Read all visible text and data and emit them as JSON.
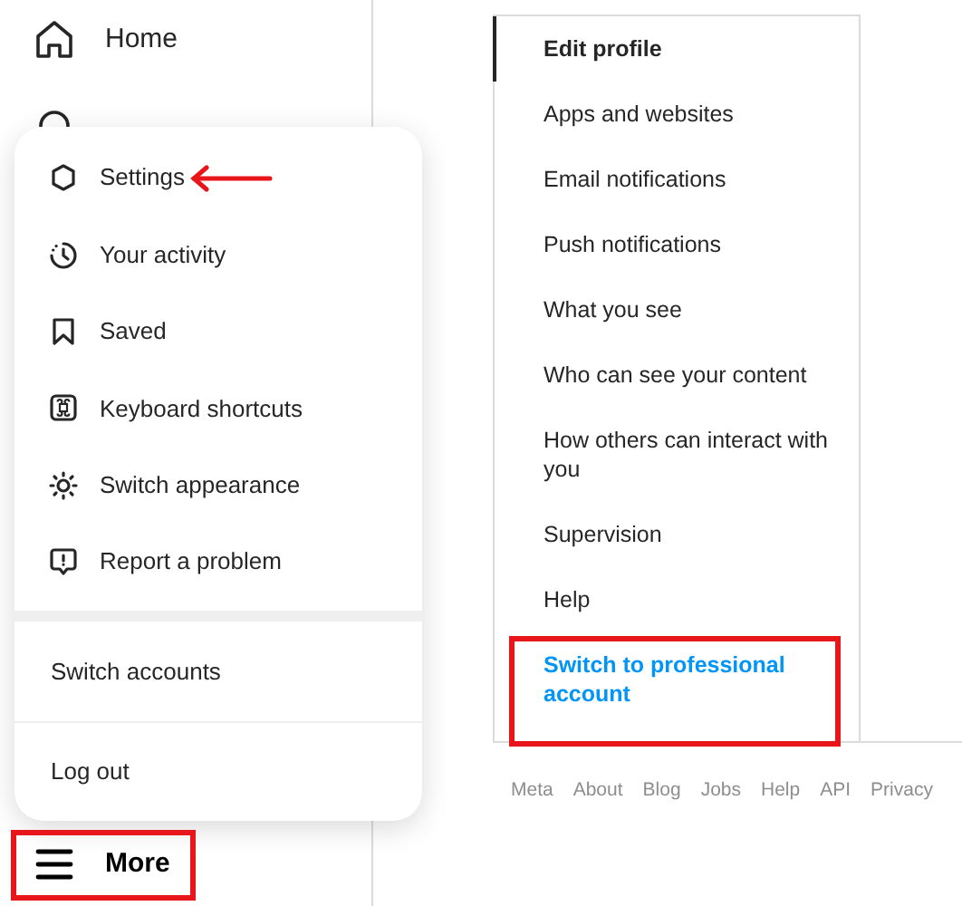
{
  "sidebar": {
    "items": [
      {
        "label": "Home",
        "selected": false
      },
      {
        "label": "More",
        "selected": true
      }
    ]
  },
  "more_menu": {
    "items": [
      {
        "label": "Settings"
      },
      {
        "label": "Your activity"
      },
      {
        "label": "Saved"
      },
      {
        "label": "Keyboard shortcuts"
      },
      {
        "label": "Switch appearance"
      },
      {
        "label": "Report a problem"
      }
    ],
    "account_actions": [
      "Switch accounts",
      "Log out"
    ]
  },
  "settings_nav": {
    "items": [
      {
        "label": "Edit profile",
        "selected": true,
        "kind": "item"
      },
      {
        "label": "Apps and websites",
        "selected": false,
        "kind": "item"
      },
      {
        "label": "Email notifications",
        "selected": false,
        "kind": "item"
      },
      {
        "label": "Push notifications",
        "selected": false,
        "kind": "item"
      },
      {
        "label": "What you see",
        "selected": false,
        "kind": "item"
      },
      {
        "label": "Who can see your content",
        "selected": false,
        "kind": "item"
      },
      {
        "label": "How others can interact with you",
        "selected": false,
        "kind": "item"
      },
      {
        "label": "Supervision",
        "selected": false,
        "kind": "item"
      },
      {
        "label": "Help",
        "selected": false,
        "kind": "item"
      },
      {
        "label": "Switch to professional account",
        "selected": false,
        "kind": "link"
      }
    ]
  },
  "footer_links": [
    "Meta",
    "About",
    "Blog",
    "Jobs",
    "Help",
    "API",
    "Privacy"
  ]
}
